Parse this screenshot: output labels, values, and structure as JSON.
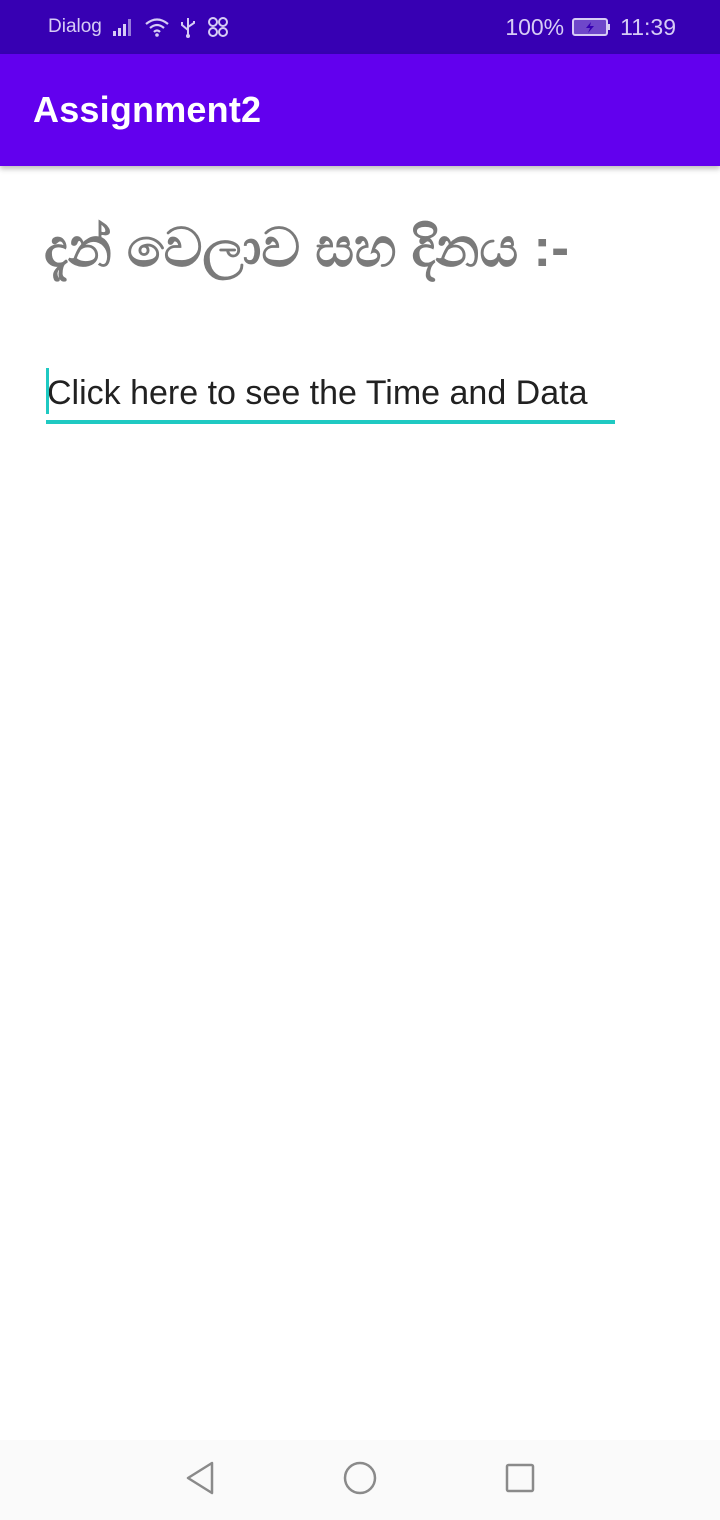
{
  "status_bar": {
    "carrier": "Dialog",
    "battery_percent": "100%",
    "time": "11:39",
    "icons": [
      "signal-icon",
      "wifi-icon",
      "usb-icon",
      "nfc-icon",
      "battery-charging-icon"
    ]
  },
  "app_bar": {
    "title": "Assignment2"
  },
  "main": {
    "heading": "දැන් වෙලාව සහ දිනය :-",
    "input_text": "Click here to see the Time and Data"
  },
  "colors": {
    "status_bar": "#3700b3",
    "app_bar": "#6200ee",
    "accent": "#1fc9c2",
    "heading_text": "#7a7a7a"
  },
  "nav_bar": {
    "icons": [
      "back-icon",
      "home-icon",
      "recents-icon"
    ]
  }
}
